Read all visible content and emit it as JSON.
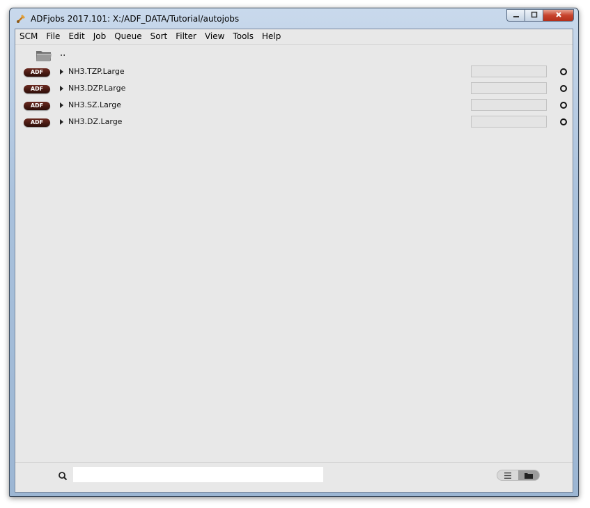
{
  "window": {
    "title": "ADFjobs 2017.101: X:/ADF_DATA/Tutorial/autojobs",
    "controls": {
      "minimize_icon": "minimize-icon",
      "maximize_icon": "maximize-icon",
      "close_icon": "close-icon"
    }
  },
  "menu": {
    "items": [
      "SCM",
      "File",
      "Edit",
      "Job",
      "Queue",
      "Sort",
      "Filter",
      "View",
      "Tools",
      "Help"
    ]
  },
  "browser": {
    "parent_label": "..",
    "jobs": [
      {
        "badge": "ADF",
        "name": "NH3.TZP.Large"
      },
      {
        "badge": "ADF",
        "name": "NH3.DZP.Large"
      },
      {
        "badge": "ADF",
        "name": "NH3.SZ.Large"
      },
      {
        "badge": "ADF",
        "name": "NH3.DZ.Large"
      }
    ]
  },
  "footer": {
    "search_value": "",
    "search_placeholder": "",
    "view_toggle": [
      "list-view-icon",
      "folder-view-icon"
    ],
    "active_view": "folder-view-icon"
  },
  "colors": {
    "badge": "#3a120c",
    "content_bg": "#e8e8e8",
    "title_bar": "#b4c8e0"
  }
}
